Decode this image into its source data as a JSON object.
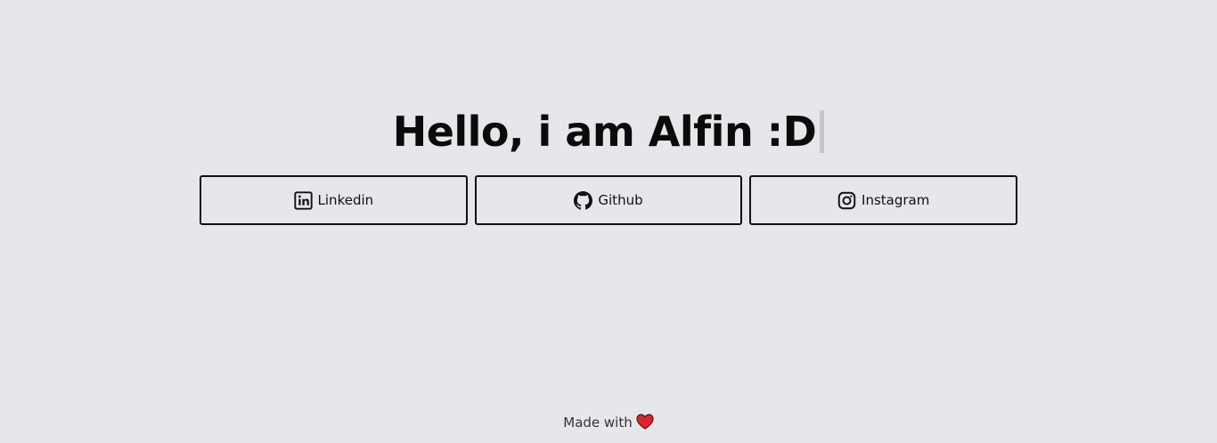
{
  "header": {
    "title": "Hello, i am Alfin :D"
  },
  "links": [
    {
      "label": "Linkedin",
      "icon": "linkedin-icon"
    },
    {
      "label": "Github",
      "icon": "github-icon"
    },
    {
      "label": "Instagram",
      "icon": "instagram-icon"
    }
  ],
  "footer": {
    "text": "Made with",
    "icon": "heart-icon"
  },
  "colors": {
    "background": "#e6e7ea",
    "text": "#111111",
    "heart": "#e0242b",
    "caret": "#c6c7cb"
  }
}
